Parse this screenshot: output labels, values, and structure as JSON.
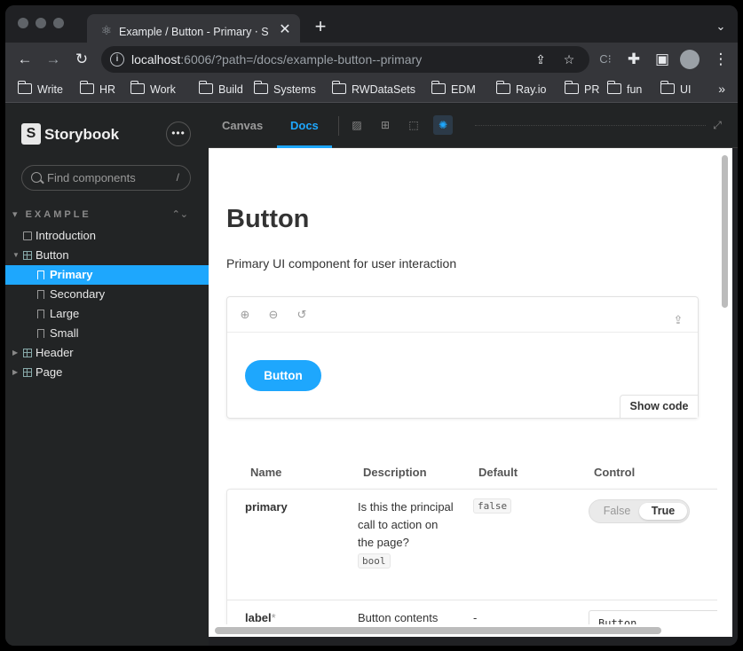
{
  "browser": {
    "tab_title": "Example / Button - Primary ⋅ S",
    "tab_close": "✕",
    "new_tab": "+",
    "tab_menu": "⌄",
    "url_host": "localhost",
    "url_rest": ":6006/?path=/docs/example-button--primary",
    "bookmarks": [
      "Write",
      "HR",
      "Work",
      "Build",
      "Systems",
      "RWDataSets",
      "EDM",
      "Ray.io",
      "PR",
      "fun",
      "UI"
    ],
    "bookmarks_more": "»",
    "icons": {
      "back": "arrow-left-icon",
      "forward": "arrow-right-icon",
      "reload": "reload-icon",
      "share": "share-icon",
      "star": "star-icon",
      "extension": "puzzle-icon",
      "sidepanel": "side-panel-icon",
      "profile": "avatar",
      "menu": "kebab-menu-icon"
    }
  },
  "sidebar": {
    "brand": "Storybook",
    "menu_glyph": "•••",
    "search_placeholder": "Find components",
    "search_shortcut": "/",
    "group": "EXAMPLE",
    "group_toggle": "⌃⌄",
    "items": [
      {
        "label": "Introduction",
        "type": "doc"
      },
      {
        "label": "Button",
        "type": "component",
        "expanded": true
      },
      {
        "label": "Primary",
        "type": "story",
        "selected": true
      },
      {
        "label": "Secondary",
        "type": "story"
      },
      {
        "label": "Large",
        "type": "story"
      },
      {
        "label": "Small",
        "type": "story"
      },
      {
        "label": "Header",
        "type": "component"
      },
      {
        "label": "Page",
        "type": "component"
      }
    ]
  },
  "main": {
    "tabs": [
      {
        "label": "Canvas",
        "active": false
      },
      {
        "label": "Docs",
        "active": true
      }
    ],
    "docs": {
      "title": "Button",
      "description": "Primary UI component for user interaction",
      "demo_button_label": "Button",
      "show_code_label": "Show code",
      "table": {
        "headers": [
          "Name",
          "Description",
          "Default",
          "Control"
        ],
        "rows": [
          {
            "name": "primary",
            "description": "Is this the principal call to action on the page?",
            "type": "bool",
            "default": "false",
            "control": {
              "type": "boolean",
              "options": [
                "False",
                "True"
              ],
              "value": "True"
            }
          },
          {
            "name": "label",
            "required_mark": "*",
            "description": "Button contents",
            "default": "-",
            "control": {
              "type": "text",
              "value": "Button"
            }
          }
        ]
      }
    }
  },
  "colors": {
    "accent": "#1ea7fd",
    "sidebar_bg": "#222425",
    "browser_bg": "#202124"
  }
}
